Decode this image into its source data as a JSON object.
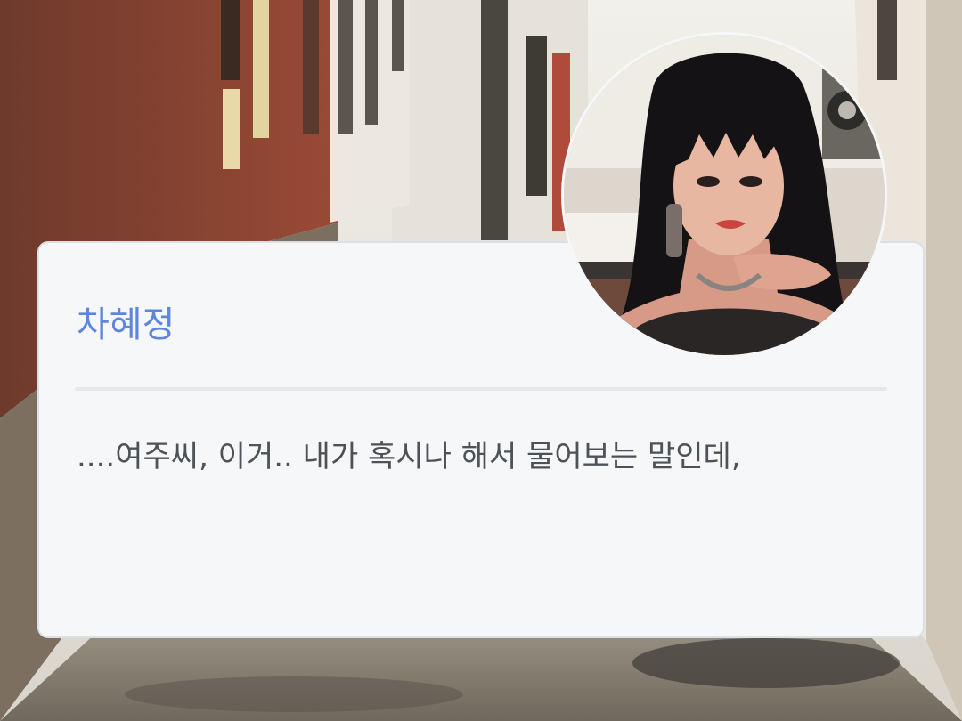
{
  "dialog": {
    "speaker": "차혜정",
    "text": "....여주씨, 이거.. 내가 혹시나 해서 물어보는 말인데,"
  },
  "avatar": {
    "icon": "character-portrait"
  },
  "background": {
    "icon": "alley-street-scene"
  }
}
